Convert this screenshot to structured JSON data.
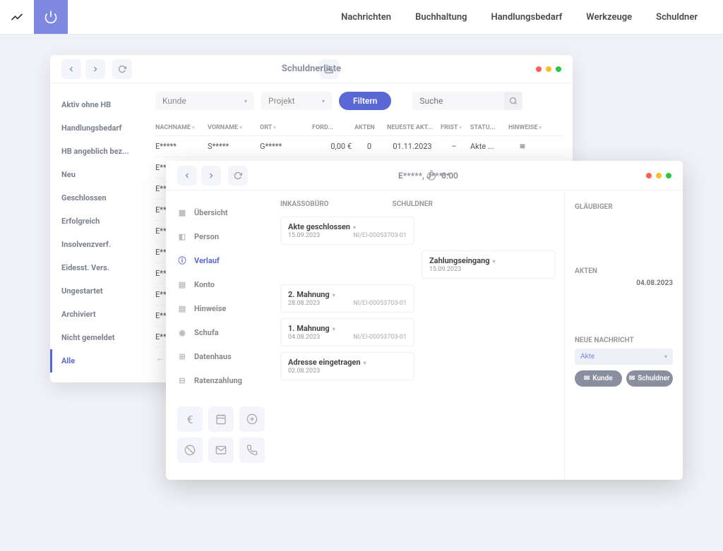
{
  "topnav": {
    "items": [
      "Nachrichten",
      "Buchhaltung",
      "Handlungsbedarf",
      "Werkzeuge",
      "Schuldner"
    ]
  },
  "win1": {
    "title": "Schuldnerliste",
    "sidebar": [
      "Aktiv ohne HB",
      "Handlungsbedarf",
      "HB angeblich bez...",
      "Neu",
      "Geschlossen",
      "Erfolgreich",
      "Insolvenzverf.",
      "Eidesst. Vers.",
      "Ungestartet",
      "Archiviert",
      "Nicht gemeldet",
      "Alle"
    ],
    "sidebar_active": 11,
    "filter": {
      "kunde": "Kunde",
      "projekt": "Projekt",
      "filtern": "Filtern",
      "suche": "Suche"
    },
    "cols": [
      "NACHNAME",
      "VORNAME",
      "ORT",
      "FORD...",
      "AKTEN",
      "NEUESTE AKT...",
      "FRIST",
      "STATU...",
      "HINWEISE"
    ],
    "rows": [
      {
        "n": "E*****",
        "v": "S*****",
        "o": "G*****",
        "f": "0,00 €",
        "a": "0",
        "d": "01.11.2023",
        "fr": "–",
        "s": "Akte ...",
        "h": "≋"
      },
      {
        "n": "E***",
        "v": "",
        "o": "",
        "f": "",
        "a": "",
        "d": "",
        "fr": "",
        "s": "",
        "h": ""
      },
      {
        "n": "E***",
        "v": "",
        "o": "",
        "f": "",
        "a": "",
        "d": "",
        "fr": "",
        "s": "",
        "h": ""
      },
      {
        "n": "E***",
        "v": "",
        "o": "",
        "f": "",
        "a": "",
        "d": "",
        "fr": "",
        "s": "",
        "h": ""
      },
      {
        "n": "E***",
        "v": "",
        "o": "",
        "f": "",
        "a": "",
        "d": "",
        "fr": "",
        "s": "",
        "h": ""
      },
      {
        "n": "E***",
        "v": "",
        "o": "",
        "f": "",
        "a": "",
        "d": "",
        "fr": "",
        "s": "",
        "h": ""
      },
      {
        "n": "E***",
        "v": "",
        "o": "",
        "f": "",
        "a": "",
        "d": "",
        "fr": "",
        "s": "",
        "h": ""
      },
      {
        "n": "E***",
        "v": "",
        "o": "",
        "f": "",
        "a": "",
        "d": "",
        "fr": "",
        "s": "",
        "h": ""
      },
      {
        "n": "E***",
        "v": "",
        "o": "",
        "f": "",
        "a": "",
        "d": "",
        "fr": "",
        "s": "",
        "h": ""
      },
      {
        "n": "E***",
        "v": "",
        "o": "",
        "f": "",
        "a": "",
        "d": "",
        "fr": "",
        "s": "",
        "h": ""
      }
    ]
  },
  "win2": {
    "title": "E*****, J*****",
    "timer": "0:00",
    "nav": [
      "Übersicht",
      "Person",
      "Verlauf",
      "Konto",
      "Hinweise",
      "Schufa",
      "Datenhaus",
      "Ratenzahlung"
    ],
    "nav_active": 2,
    "timeline": {
      "col1": "INKASSOBÜRO",
      "col2": "SCHULDNER",
      "cards": [
        {
          "side": "left",
          "title": "Akte geschlossen",
          "date": "15.09.2023",
          "ref": "NI/EI-00053703-01"
        },
        {
          "side": "right",
          "title": "Zahlungseingang",
          "date": "15.09.2023",
          "ref": ""
        },
        {
          "side": "left",
          "title": "2. Mahnung",
          "date": "28.08.2023",
          "ref": "NI/EI-00053703-01"
        },
        {
          "side": "left",
          "title": "1. Mahnung",
          "date": "04.08.2023",
          "ref": "NI/EI-00053703-01"
        },
        {
          "side": "left",
          "title": "Adresse eingetragen",
          "date": "02.08.2023",
          "ref": ""
        }
      ]
    },
    "right": {
      "glaubiger": "GLÄUBIGER",
      "akten": "AKTEN",
      "akten_date": "04.08.2023",
      "neue": "NEUE NACHRICHT",
      "akte": "Akte",
      "btn_kunde": "Kunde",
      "btn_schuldner": "Schuldner"
    }
  }
}
